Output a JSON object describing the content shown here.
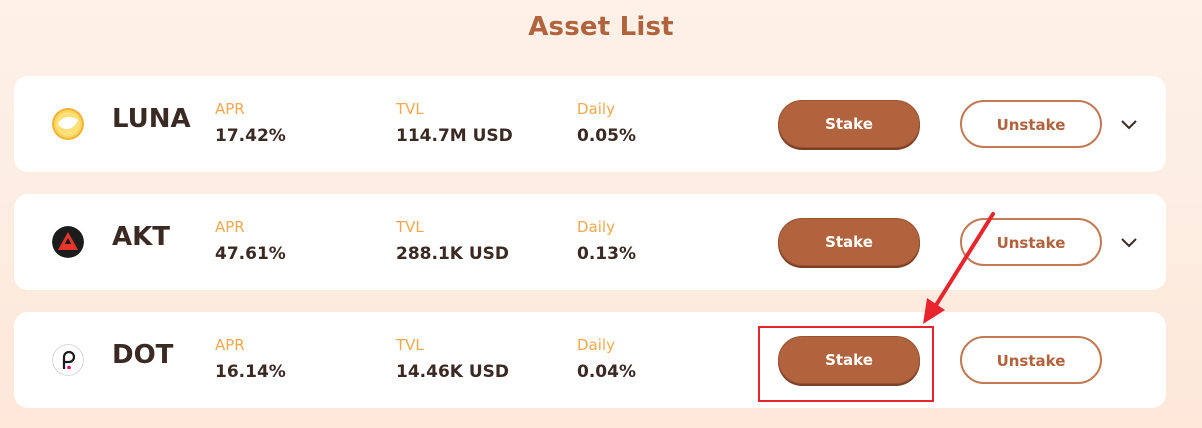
{
  "page": {
    "title": "Asset List"
  },
  "labels": {
    "apr": "APR",
    "tvl": "TVL",
    "daily": "Daily"
  },
  "buttons": {
    "stake": "Stake",
    "unstake": "Unstake"
  },
  "assets": [
    {
      "symbol": "LUNA",
      "icon": "luna-coin-icon",
      "apr": "17.42%",
      "tvl": "114.7M USD",
      "daily": "0.05%",
      "expandable": true
    },
    {
      "symbol": "AKT",
      "icon": "akash-coin-icon",
      "apr": "47.61%",
      "tvl": "288.1K USD",
      "daily": "0.13%",
      "expandable": true
    },
    {
      "symbol": "DOT",
      "icon": "polkadot-coin-icon",
      "apr": "16.14%",
      "tvl": "14.46K USD",
      "daily": "0.04%",
      "expandable": false
    }
  ],
  "annotation": {
    "color": "#e8252c",
    "target": "stake-button-dot"
  },
  "colors": {
    "accent": "#b0633d",
    "label": "#f2a84f",
    "text": "#3b2a24"
  }
}
